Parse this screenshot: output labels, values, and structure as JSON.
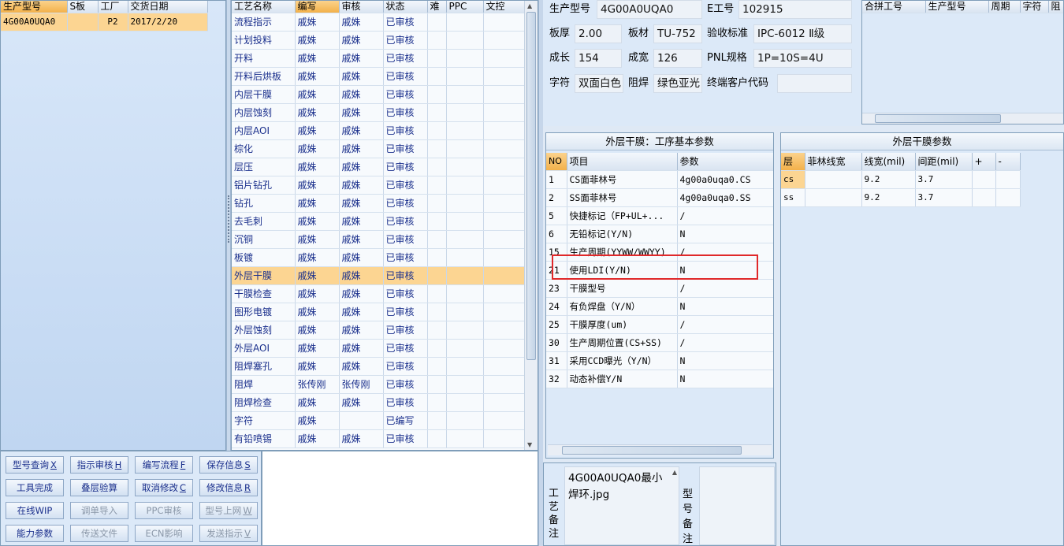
{
  "left_list": {
    "headers": [
      "生产型号",
      "S板",
      "工厂",
      "交货日期"
    ],
    "rows": [
      [
        "4G00A0UQA0",
        "",
        "P2",
        "2017/2/20"
      ]
    ]
  },
  "process_table": {
    "headers": [
      "工艺名称",
      "编写",
      "审核",
      "状态",
      "难",
      "PPC",
      "文控"
    ],
    "rows": [
      [
        "流程指示",
        "戚姝",
        "戚姝",
        "已审核"
      ],
      [
        "计划投料",
        "戚姝",
        "戚姝",
        "已审核"
      ],
      [
        "开料",
        "戚姝",
        "戚姝",
        "已审核"
      ],
      [
        "开料后烘板",
        "戚姝",
        "戚姝",
        "已审核"
      ],
      [
        "内层干膜",
        "戚姝",
        "戚姝",
        "已审核"
      ],
      [
        "内层蚀刻",
        "戚姝",
        "戚姝",
        "已审核"
      ],
      [
        "内层AOI",
        "戚姝",
        "戚姝",
        "已审核"
      ],
      [
        "棕化",
        "戚姝",
        "戚姝",
        "已审核"
      ],
      [
        "层压",
        "戚姝",
        "戚姝",
        "已审核"
      ],
      [
        "铝片钻孔",
        "戚姝",
        "戚姝",
        "已审核"
      ],
      [
        "钻孔",
        "戚姝",
        "戚姝",
        "已审核"
      ],
      [
        "去毛刺",
        "戚姝",
        "戚姝",
        "已审核"
      ],
      [
        "沉铜",
        "戚姝",
        "戚姝",
        "已审核"
      ],
      [
        "板镀",
        "戚姝",
        "戚姝",
        "已审核"
      ],
      [
        "外层干膜",
        "戚姝",
        "戚姝",
        "已审核"
      ],
      [
        "干膜检查",
        "戚姝",
        "戚姝",
        "已审核"
      ],
      [
        "图形电镀",
        "戚姝",
        "戚姝",
        "已审核"
      ],
      [
        "外层蚀刻",
        "戚姝",
        "戚姝",
        "已审核"
      ],
      [
        "外层AOI",
        "戚姝",
        "戚姝",
        "已审核"
      ],
      [
        "阻焊塞孔",
        "戚姝",
        "戚姝",
        "已审核"
      ],
      [
        "阻焊",
        "张传刚",
        "张传刚",
        "已审核"
      ],
      [
        "阻焊检查",
        "戚姝",
        "戚姝",
        "已审核"
      ],
      [
        "字符",
        "戚姝",
        "",
        "已编写"
      ],
      [
        "有铅喷锡",
        "戚姝",
        "戚姝",
        "已审核"
      ]
    ],
    "selected_index": 14
  },
  "buttons": [
    {
      "label": "型号查询",
      "key": "X",
      "enabled": true
    },
    {
      "label": "指示审核",
      "key": "H",
      "enabled": true
    },
    {
      "label": "编写流程",
      "key": "F",
      "enabled": true
    },
    {
      "label": "保存信息",
      "key": "S",
      "enabled": true
    },
    {
      "label": "工具完成",
      "key": "",
      "enabled": true
    },
    {
      "label": "叠层验算",
      "key": "",
      "enabled": true
    },
    {
      "label": "取消修改",
      "key": "C",
      "enabled": true
    },
    {
      "label": "修改信息",
      "key": "R",
      "enabled": true
    },
    {
      "label": "在线WIP",
      "key": "",
      "enabled": true
    },
    {
      "label": "调单导入",
      "key": "",
      "enabled": false
    },
    {
      "label": "PPC审核",
      "key": "",
      "enabled": false
    },
    {
      "label": "型号上网",
      "key": "W",
      "enabled": false
    },
    {
      "label": "能力参数",
      "key": "",
      "enabled": true
    },
    {
      "label": "传送文件",
      "key": "",
      "enabled": false
    },
    {
      "label": "ECN影响",
      "key": "",
      "enabled": false
    },
    {
      "label": "发送指示",
      "key": "V",
      "enabled": false
    }
  ],
  "info": {
    "model_label": "生产型号",
    "model_value": "4G00A0UQA0",
    "eno_label": "E工号",
    "eno_value": "102915",
    "thickness_label": "板厚",
    "thickness_value": "2.00",
    "material_label": "板材",
    "material_value": "TU-752",
    "standard_label": "验收标准",
    "standard_value": "IPC-6012 Ⅱ级",
    "length_label": "成长",
    "length_value": "154",
    "width_label": "成宽",
    "width_value": "126",
    "pnl_label": "PNL规格",
    "pnl_value": "1P=10S=4U",
    "char_label": "字符",
    "char_value": "双面白色",
    "mask_label": "阻焊",
    "mask_value": "绿色亚光",
    "customer_label": "终端客户代码",
    "customer_value": ""
  },
  "merge_table": {
    "headers": [
      "合拼工号",
      "生产型号",
      "周期",
      "字符",
      "阻"
    ]
  },
  "basic_params": {
    "title": "外层干膜：工序基本参数",
    "headers": [
      "NO",
      "项目",
      "参数"
    ],
    "rows": [
      [
        "1",
        "CS面菲林号",
        "4g00a0uqa0.CS"
      ],
      [
        "2",
        "SS面菲林号",
        "4g00a0uqa0.SS"
      ],
      [
        "5",
        "快捷标记（FP+UL+...",
        "/"
      ],
      [
        "6",
        "无铅标记(Y/N)",
        "N"
      ],
      [
        "15",
        "生产周期(YYWW/WWYY)",
        "/"
      ],
      [
        "21",
        "使用LDI(Y/N)",
        "N"
      ],
      [
        "23",
        "干膜型号",
        "/"
      ],
      [
        "24",
        "有负焊盘（Y/N）",
        "N"
      ],
      [
        "25",
        "干膜厚度(um)",
        "/"
      ],
      [
        "30",
        "生产周期位置(CS+SS)",
        "/"
      ],
      [
        "31",
        "采用CCD曝光（Y/N）",
        "N"
      ],
      [
        "32",
        "动态补偿Y/N",
        "N"
      ]
    ],
    "highlight_color": "#e0282a"
  },
  "layer_params": {
    "title": "外层干膜参数",
    "headers": [
      "层",
      "菲林线宽",
      "线宽(mil)",
      "间距(mil)",
      "+",
      "-"
    ],
    "rows": [
      [
        "cs",
        "",
        "9.2",
        "3.7",
        "",
        ""
      ],
      [
        "ss",
        "",
        "9.2",
        "3.7",
        "",
        ""
      ]
    ]
  },
  "remarks": {
    "label_process": "工艺备注",
    "process_text": "4G00A0UQA0最小焊环.jpg",
    "label_model": "型号备注"
  }
}
